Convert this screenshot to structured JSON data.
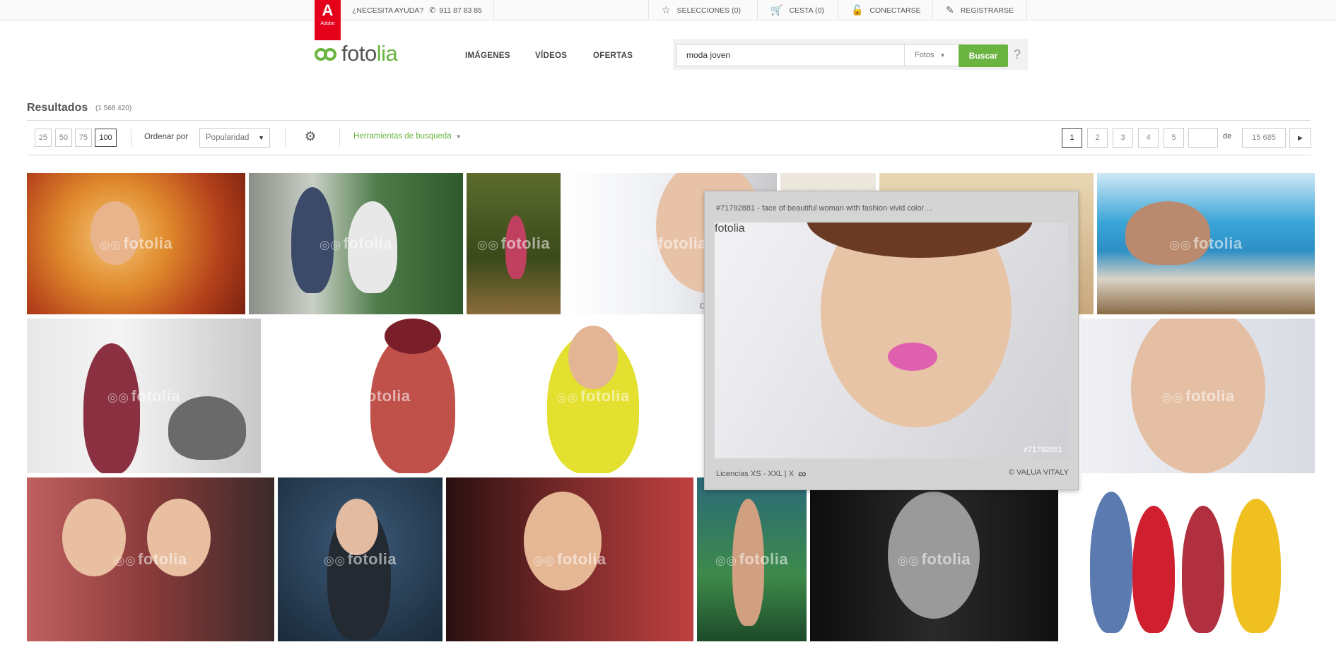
{
  "topbar": {
    "adobe_label": "Adobe",
    "help_text": "¿NECESITA AYUDA?",
    "phone": "911 87 83 85",
    "selecciones": "SELECCIONES (0)",
    "cesta": "CESTA (0)",
    "conectarse": "CONECTARSE",
    "registrarse": "REGISTRARSE"
  },
  "header": {
    "logo_part1": "foto",
    "logo_part2": "lia",
    "nav": [
      "IMÁGENES",
      "VÍDEOS",
      "OFERTAS"
    ],
    "search_value": "moda joven",
    "search_type": "Fotos",
    "search_button": "Buscar",
    "help": "?"
  },
  "results": {
    "title": "Resultados",
    "count": "(1 568 420)",
    "per_page": [
      "25",
      "50",
      "75",
      "100"
    ],
    "per_page_selected": "100",
    "sort_label": "Ordenar por",
    "sort_value": "Popularidad",
    "tools_label": "Herramientas de busqueda",
    "pages": [
      "1",
      "2",
      "3",
      "4",
      "5"
    ],
    "current_page": "1",
    "of_label": "de",
    "total_pages": "15 685"
  },
  "watermark": "fotolia",
  "preview": {
    "title": "#71792881 - face of beautiful woman with fashion vivid color ...",
    "image_id": "#71792881",
    "license": "Licencias XS - XXL | X",
    "author": "© VALUA VITALY"
  },
  "colors": {
    "brand_green": "#6bb440",
    "adobe_red": "#e4001b"
  },
  "icons": {
    "phone": "phone-icon",
    "star": "star-icon",
    "cart": "cart-icon",
    "lock": "lock-icon",
    "edit": "edit-icon",
    "gear": "gear-icon",
    "infinity": "infinity-icon"
  }
}
